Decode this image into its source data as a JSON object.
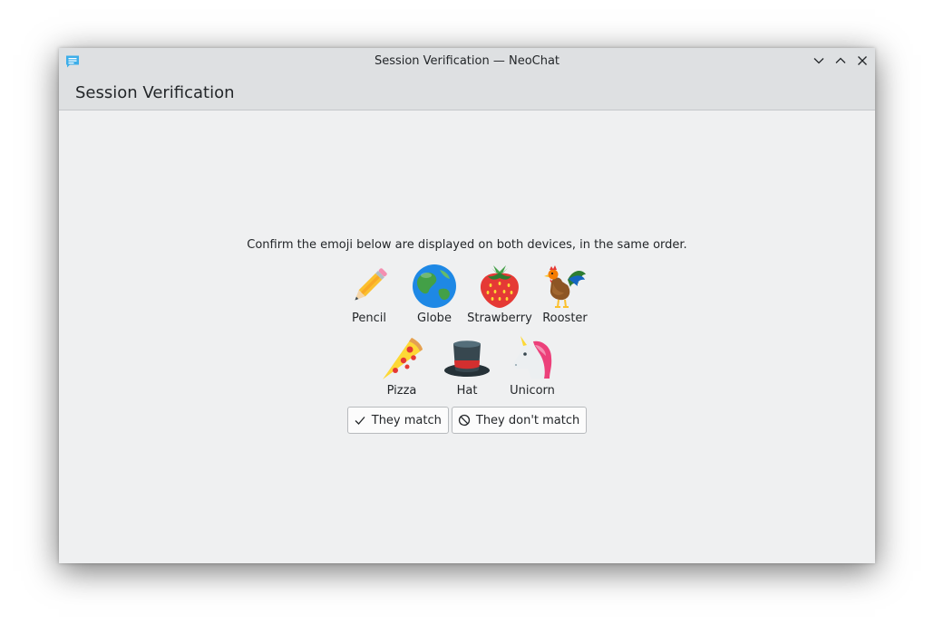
{
  "window": {
    "title": "Session Verification — NeoChat",
    "controls": {
      "minimize": "chevron-down-icon",
      "maximize": "chevron-up-icon",
      "close": "close-icon"
    }
  },
  "header": {
    "title": "Session Verification"
  },
  "verification": {
    "instructions": "Confirm the emoji below are displayed on both devices, in the same order.",
    "emoji_rows": [
      [
        {
          "icon": "pencil-emoji",
          "label": "Pencil"
        },
        {
          "icon": "globe-emoji",
          "label": "Globe"
        },
        {
          "icon": "strawberry-emoji",
          "label": "Strawberry"
        },
        {
          "icon": "rooster-emoji",
          "label": "Rooster"
        }
      ],
      [
        {
          "icon": "pizza-emoji",
          "label": "Pizza"
        },
        {
          "icon": "hat-emoji",
          "label": "Hat"
        },
        {
          "icon": "unicorn-emoji",
          "label": "Unicorn"
        }
      ]
    ],
    "match_button": {
      "label": "They match",
      "icon": "checkmark-icon"
    },
    "nomatch_button": {
      "label": "They don't match",
      "icon": "prohibited-icon"
    }
  },
  "colors": {
    "window_bg": "#eff0f1",
    "header_bg": "#dee0e2",
    "text": "#232629"
  }
}
